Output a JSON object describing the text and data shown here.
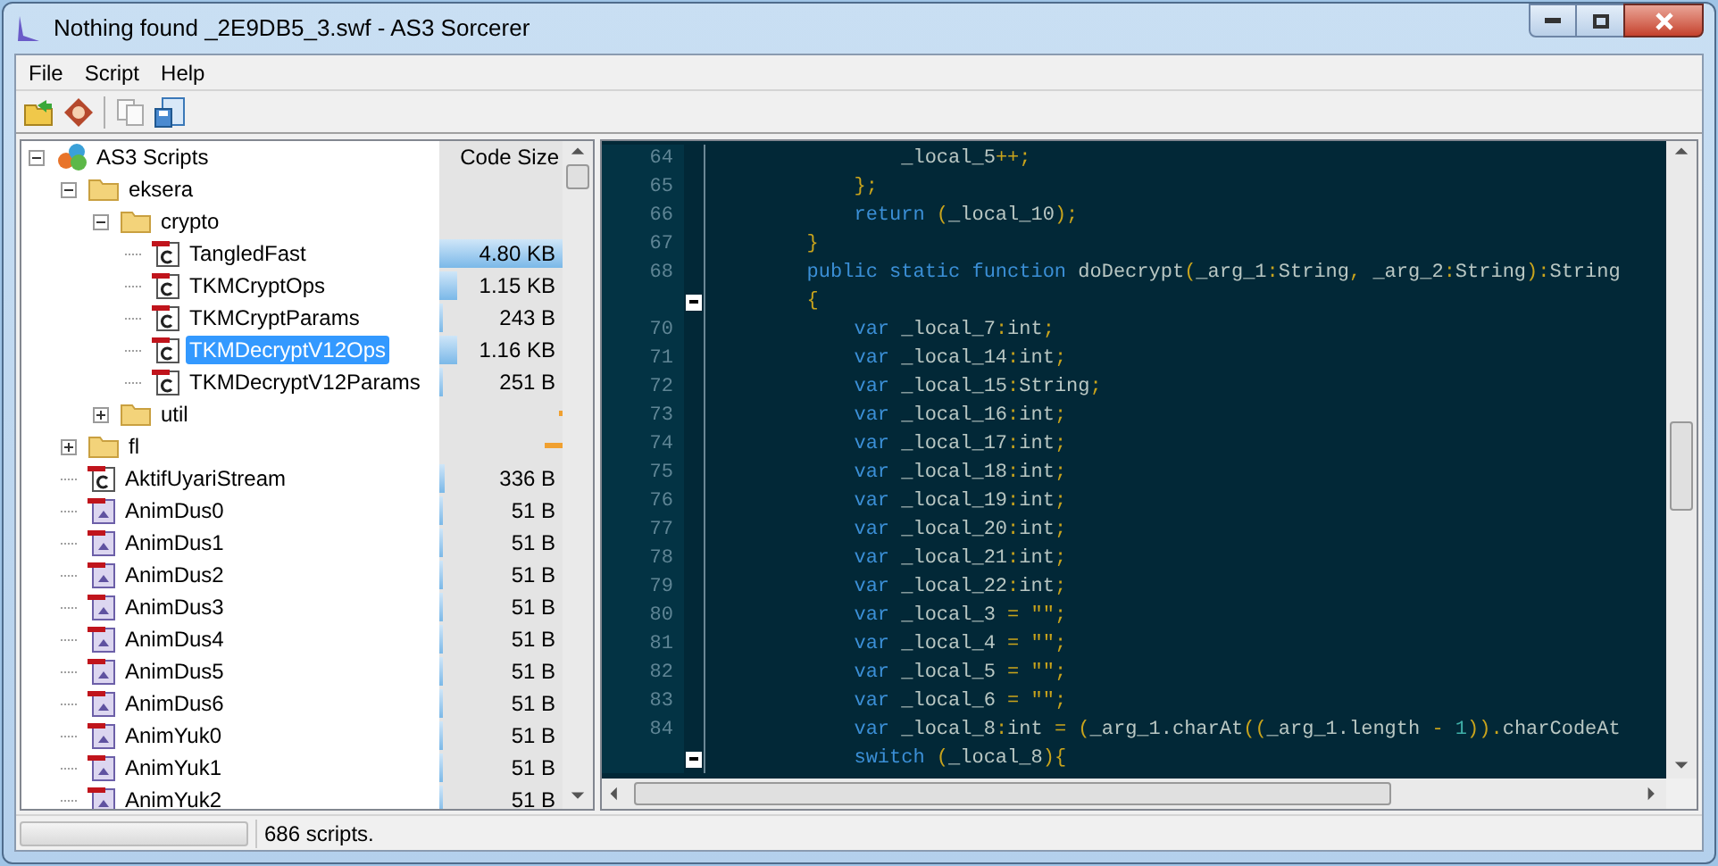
{
  "window": {
    "title": "Nothing found _2E9DB5_3.swf - AS3 Sorcerer"
  },
  "menu": [
    "File",
    "Script",
    "Help"
  ],
  "toolbar": [
    {
      "kind": "open"
    },
    {
      "kind": "info"
    },
    {
      "kind": "sep"
    },
    {
      "kind": "copy"
    },
    {
      "kind": "save"
    }
  ],
  "tree": {
    "column": "Code Size",
    "items": [
      {
        "label": "AS3 Scripts",
        "kind": "root",
        "expanded": true,
        "selected": false,
        "children": [
          {
            "label": "eksera",
            "kind": "folder",
            "expanded": true,
            "selected": false,
            "children": [
              {
                "label": "crypto",
                "kind": "folder",
                "expanded": true,
                "selected": false,
                "children": [
                  {
                    "label": "TangledFast",
                    "kind": "class",
                    "selected": false,
                    "size": "4.80 KB",
                    "level": 1.0
                  },
                  {
                    "label": "TKMCryptOps",
                    "kind": "class",
                    "selected": false,
                    "size": "1.15 KB",
                    "level": 0.14
                  },
                  {
                    "label": "TKMCryptParams",
                    "kind": "class",
                    "selected": false,
                    "size": "243 B",
                    "level": 0.03
                  },
                  {
                    "label": "TKMDecryptV12Ops",
                    "kind": "class",
                    "selected": true,
                    "size": "1.16 KB",
                    "level": 0.14
                  },
                  {
                    "label": "TKMDecryptV12Params",
                    "kind": "class",
                    "selected": false,
                    "size": "251 B",
                    "level": 0.03
                  }
                ]
              },
              {
                "label": "util",
                "kind": "folder",
                "expanded": false,
                "selected": false,
                "level": 0.02
              }
            ]
          },
          {
            "label": "fl",
            "kind": "folder",
            "expanded": false,
            "selected": false,
            "level": 0.15
          },
          {
            "label": "AktifUyariStream",
            "kind": "class",
            "selected": false,
            "size": "336 B",
            "level": 0.04
          },
          {
            "label": "AnimDus0",
            "kind": "sprite",
            "selected": false,
            "size": "51 B",
            "level": 0.01
          },
          {
            "label": "AnimDus1",
            "kind": "sprite",
            "selected": false,
            "size": "51 B",
            "level": 0.01
          },
          {
            "label": "AnimDus2",
            "kind": "sprite",
            "selected": false,
            "size": "51 B",
            "level": 0.01
          },
          {
            "label": "AnimDus3",
            "kind": "sprite",
            "selected": false,
            "size": "51 B",
            "level": 0.01
          },
          {
            "label": "AnimDus4",
            "kind": "sprite",
            "selected": false,
            "size": "51 B",
            "level": 0.01
          },
          {
            "label": "AnimDus5",
            "kind": "sprite",
            "selected": false,
            "size": "51 B",
            "level": 0.01
          },
          {
            "label": "AnimDus6",
            "kind": "sprite",
            "selected": false,
            "size": "51 B",
            "level": 0.01
          },
          {
            "label": "AnimYuk0",
            "kind": "sprite",
            "selected": false,
            "size": "51 B",
            "level": 0.01
          },
          {
            "label": "AnimYuk1",
            "kind": "sprite",
            "selected": false,
            "size": "51 B",
            "level": 0.01
          },
          {
            "label": "AnimYuk2",
            "kind": "sprite",
            "selected": false,
            "size": "51 B",
            "level": 0.01
          }
        ]
      }
    ]
  },
  "code": [
    {
      "number": "64",
      "tokens": [
        {
          "kind": "id",
          "text": "                _local_5"
        },
        {
          "kind": "op",
          "text": "++;"
        }
      ]
    },
    {
      "number": "65",
      "tokens": [
        {
          "kind": "op",
          "text": "            };"
        }
      ]
    },
    {
      "number": "66",
      "tokens": [
        {
          "kind": "kw",
          "text": "            return "
        },
        {
          "kind": "op",
          "text": "("
        },
        {
          "kind": "id",
          "text": "_local_10"
        },
        {
          "kind": "op",
          "text": ");"
        }
      ]
    },
    {
      "number": "67",
      "tokens": [
        {
          "kind": "op",
          "text": "        }"
        }
      ]
    },
    {
      "number": "68",
      "tokens": [
        {
          "kind": "kw",
          "text": "        public static function "
        },
        {
          "kind": "id",
          "text": "doDecrypt"
        },
        {
          "kind": "op",
          "text": "("
        },
        {
          "kind": "id",
          "text": "_arg_1"
        },
        {
          "kind": "op",
          "text": ":"
        },
        {
          "kind": "id",
          "text": "String"
        },
        {
          "kind": "op",
          "text": ", "
        },
        {
          "kind": "id",
          "text": "_arg_2"
        },
        {
          "kind": "op",
          "text": ":"
        },
        {
          "kind": "id",
          "text": "String"
        },
        {
          "kind": "op",
          "text": "):"
        },
        {
          "kind": "id",
          "text": "String"
        }
      ]
    },
    {
      "fold": true,
      "tokens": [
        {
          "kind": "op",
          "text": "        {"
        }
      ]
    },
    {
      "number": "70",
      "tokens": [
        {
          "kind": "kw",
          "text": "            var "
        },
        {
          "kind": "id",
          "text": "_local_7"
        },
        {
          "kind": "op",
          "text": ":"
        },
        {
          "kind": "id",
          "text": "int"
        },
        {
          "kind": "op",
          "text": ";"
        }
      ]
    },
    {
      "number": "71",
      "tokens": [
        {
          "kind": "kw",
          "text": "            var "
        },
        {
          "kind": "id",
          "text": "_local_14"
        },
        {
          "kind": "op",
          "text": ":"
        },
        {
          "kind": "id",
          "text": "int"
        },
        {
          "kind": "op",
          "text": ";"
        }
      ]
    },
    {
      "number": "72",
      "tokens": [
        {
          "kind": "kw",
          "text": "            var "
        },
        {
          "kind": "id",
          "text": "_local_15"
        },
        {
          "kind": "op",
          "text": ":"
        },
        {
          "kind": "id",
          "text": "String"
        },
        {
          "kind": "op",
          "text": ";"
        }
      ]
    },
    {
      "number": "73",
      "tokens": [
        {
          "kind": "kw",
          "text": "            var "
        },
        {
          "kind": "id",
          "text": "_local_16"
        },
        {
          "kind": "op",
          "text": ":"
        },
        {
          "kind": "id",
          "text": "int"
        },
        {
          "kind": "op",
          "text": ";"
        }
      ]
    },
    {
      "number": "74",
      "tokens": [
        {
          "kind": "kw",
          "text": "            var "
        },
        {
          "kind": "id",
          "text": "_local_17"
        },
        {
          "kind": "op",
          "text": ":"
        },
        {
          "kind": "id",
          "text": "int"
        },
        {
          "kind": "op",
          "text": ";"
        }
      ]
    },
    {
      "number": "75",
      "tokens": [
        {
          "kind": "kw",
          "text": "            var "
        },
        {
          "kind": "id",
          "text": "_local_18"
        },
        {
          "kind": "op",
          "text": ":"
        },
        {
          "kind": "id",
          "text": "int"
        },
        {
          "kind": "op",
          "text": ";"
        }
      ]
    },
    {
      "number": "76",
      "tokens": [
        {
          "kind": "kw",
          "text": "            var "
        },
        {
          "kind": "id",
          "text": "_local_19"
        },
        {
          "kind": "op",
          "text": ":"
        },
        {
          "kind": "id",
          "text": "int"
        },
        {
          "kind": "op",
          "text": ";"
        }
      ]
    },
    {
      "number": "77",
      "tokens": [
        {
          "kind": "kw",
          "text": "            var "
        },
        {
          "kind": "id",
          "text": "_local_20"
        },
        {
          "kind": "op",
          "text": ":"
        },
        {
          "kind": "id",
          "text": "int"
        },
        {
          "kind": "op",
          "text": ";"
        }
      ]
    },
    {
      "number": "78",
      "tokens": [
        {
          "kind": "kw",
          "text": "            var "
        },
        {
          "kind": "id",
          "text": "_local_21"
        },
        {
          "kind": "op",
          "text": ":"
        },
        {
          "kind": "id",
          "text": "int"
        },
        {
          "kind": "op",
          "text": ";"
        }
      ]
    },
    {
      "number": "79",
      "tokens": [
        {
          "kind": "kw",
          "text": "            var "
        },
        {
          "kind": "id",
          "text": "_local_22"
        },
        {
          "kind": "op",
          "text": ":"
        },
        {
          "kind": "id",
          "text": "int"
        },
        {
          "kind": "op",
          "text": ";"
        }
      ]
    },
    {
      "number": "80",
      "tokens": [
        {
          "kind": "kw",
          "text": "            var "
        },
        {
          "kind": "id",
          "text": "_local_3 "
        },
        {
          "kind": "op",
          "text": "= \"\";"
        }
      ]
    },
    {
      "number": "81",
      "tokens": [
        {
          "kind": "kw",
          "text": "            var "
        },
        {
          "kind": "id",
          "text": "_local_4 "
        },
        {
          "kind": "op",
          "text": "= \"\";"
        }
      ]
    },
    {
      "number": "82",
      "tokens": [
        {
          "kind": "kw",
          "text": "            var "
        },
        {
          "kind": "id",
          "text": "_local_5 "
        },
        {
          "kind": "op",
          "text": "= \"\";"
        }
      ]
    },
    {
      "number": "83",
      "tokens": [
        {
          "kind": "kw",
          "text": "            var "
        },
        {
          "kind": "id",
          "text": "_local_6 "
        },
        {
          "kind": "op",
          "text": "= \"\";"
        }
      ]
    },
    {
      "number": "84",
      "tokens": [
        {
          "kind": "kw",
          "text": "            var "
        },
        {
          "kind": "id",
          "text": "_local_8"
        },
        {
          "kind": "op",
          "text": ":"
        },
        {
          "kind": "id",
          "text": "int "
        },
        {
          "kind": "op",
          "text": "= ("
        },
        {
          "kind": "id",
          "text": "_arg_1.charAt"
        },
        {
          "kind": "op",
          "text": "(("
        },
        {
          "kind": "id",
          "text": "_arg_1.length "
        },
        {
          "kind": "op",
          "text": "- "
        },
        {
          "kind": "num",
          "text": "1"
        },
        {
          "kind": "op",
          "text": "))."
        },
        {
          "kind": "id",
          "text": "charCodeAt"
        }
      ]
    },
    {
      "fold": true,
      "tokens": [
        {
          "kind": "kw",
          "text": "            switch "
        },
        {
          "kind": "op",
          "text": "("
        },
        {
          "kind": "id",
          "text": "_local_8"
        },
        {
          "kind": "op",
          "text": "){"
        }
      ]
    }
  ],
  "status": "686 scripts."
}
